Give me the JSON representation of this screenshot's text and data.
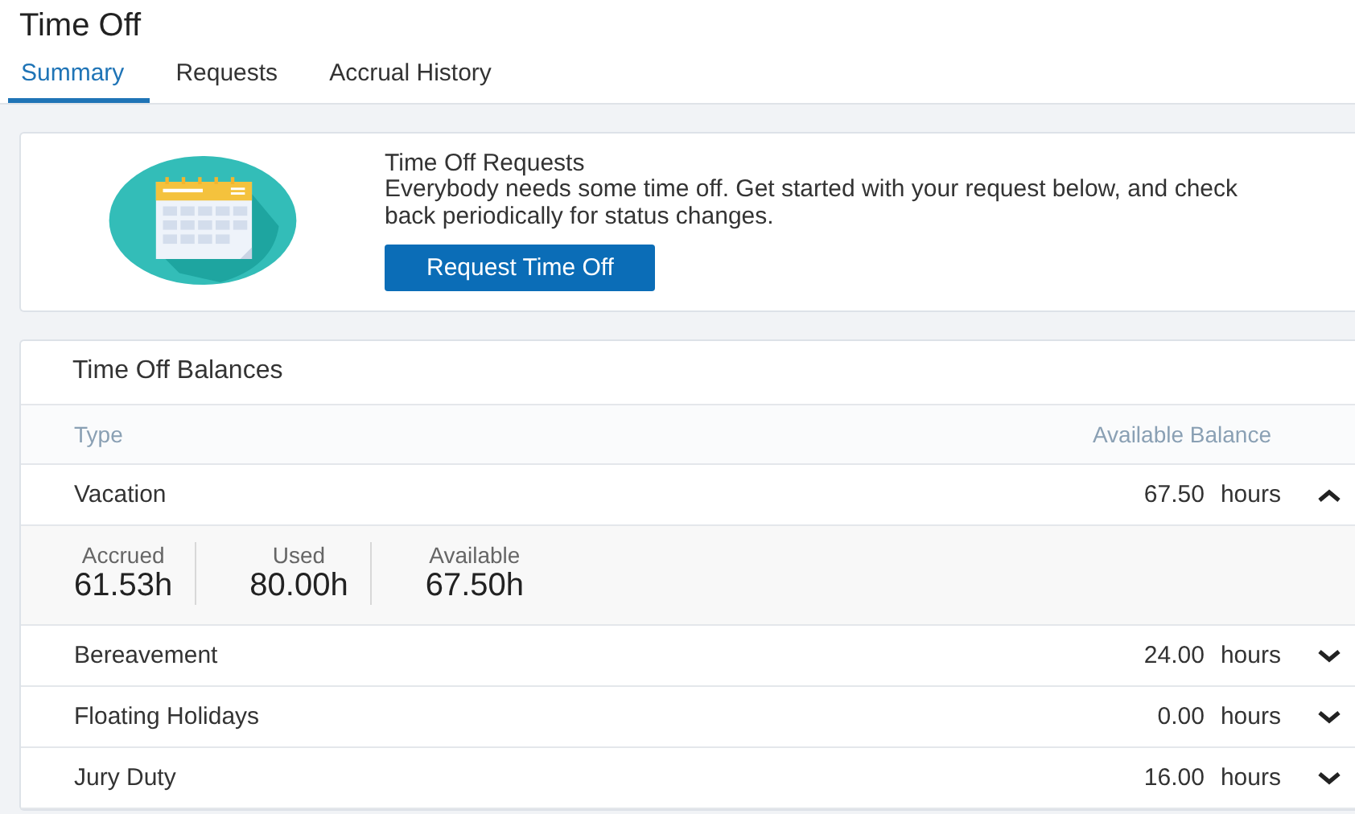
{
  "page_title": "Time Off",
  "tabs": [
    {
      "label": "Summary",
      "selected": true
    },
    {
      "label": "Requests",
      "selected": false
    },
    {
      "label": "Accrual History",
      "selected": false
    }
  ],
  "requests_card": {
    "title": "Time Off Requests",
    "text": "Everybody needs some time off. Get started with your request below, and check back periodically for status changes.",
    "button": "Request Time Off"
  },
  "balances": {
    "title": "Time Off Balances",
    "columns": [
      "Type",
      "Available Balance"
    ],
    "rows": [
      {
        "type": "Vacation",
        "amount": "67.50",
        "unit": "hours",
        "expanded": true,
        "details": [
          {
            "label": "Accrued",
            "value": "61.53h"
          },
          {
            "label": "Used",
            "value": "80.00h"
          },
          {
            "label": "Available",
            "value": "67.50h"
          }
        ]
      },
      {
        "type": "Bereavement",
        "amount": "24.00",
        "unit": "hours",
        "expanded": false
      },
      {
        "type": "Floating Holidays",
        "amount": "0.00",
        "unit": "hours",
        "expanded": false
      },
      {
        "type": "Jury Duty",
        "amount": "16.00",
        "unit": "hours",
        "expanded": false
      }
    ]
  }
}
